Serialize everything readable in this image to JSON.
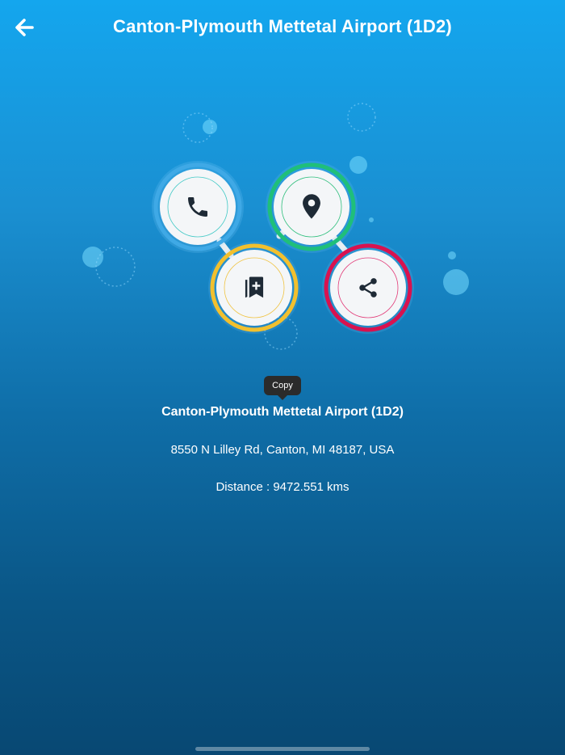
{
  "header": {
    "title": "Canton-Plymouth Mettetal Airport (1D2)",
    "back_icon": "arrow-left-icon"
  },
  "actions": [
    {
      "name": "call",
      "icon": "phone-icon",
      "ring_color": "#3fa9e6"
    },
    {
      "name": "map",
      "icon": "map-pin-icon",
      "ring_color": "#1fbf7a"
    },
    {
      "name": "bookmark",
      "icon": "bookmark-add-icon",
      "ring_color": "#f2c02e"
    },
    {
      "name": "share",
      "icon": "share-icon",
      "ring_color": "#d8124f"
    }
  ],
  "tooltip": {
    "label": "Copy"
  },
  "details": {
    "name": "Canton-Plymouth Mettetal Airport (1D2)",
    "address": "8550 N Lilley Rd, Canton, MI 48187, USA",
    "distance": "Distance : 9472.551 kms"
  },
  "colors": {
    "bg_top": "#14a6ee",
    "bg_bottom": "#084873",
    "icon_dark": "#1e2a36"
  }
}
